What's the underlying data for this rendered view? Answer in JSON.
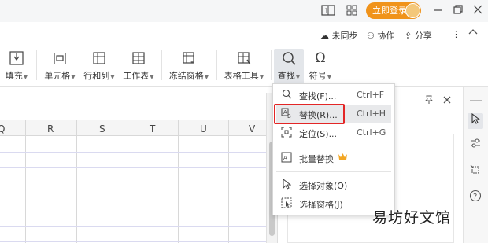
{
  "titlebar": {
    "login_label": "立即登录",
    "icons": [
      "layout-icon",
      "grid-icon",
      "avatar",
      "minimize-icon",
      "restore-icon",
      "close-icon"
    ]
  },
  "ribbon_top": {
    "sync_label": "未同步",
    "collab_label": "协作",
    "share_label": "分享"
  },
  "ribbon": {
    "fill_label": "填充",
    "cell_label": "单元格",
    "rowcol_label": "行和列",
    "sheet_label": "工作表",
    "freeze_label": "冻结窗格",
    "tools_label": "表格工具",
    "find_label": "查找",
    "symbol_label": "符号"
  },
  "grid": {
    "columns": [
      "Q",
      "R",
      "S",
      "T",
      "U",
      "V"
    ]
  },
  "find_menu": {
    "items": [
      {
        "label": "查找(F)...",
        "shortcut": "Ctrl+F"
      },
      {
        "label": "替换(R)...",
        "shortcut": "Ctrl+H"
      },
      {
        "label": "定位(S)...",
        "shortcut": "Ctrl+G"
      },
      {
        "label": "批量替换",
        "shortcut": ""
      },
      {
        "label": "选择对象(O)",
        "shortcut": ""
      },
      {
        "label": "选择窗格(J)",
        "shortcut": ""
      }
    ]
  },
  "watermark": "易坊好文馆",
  "colors": {
    "login_button": "#f0931b",
    "highlight_border": "#e32626",
    "crown": "#f2a624"
  }
}
